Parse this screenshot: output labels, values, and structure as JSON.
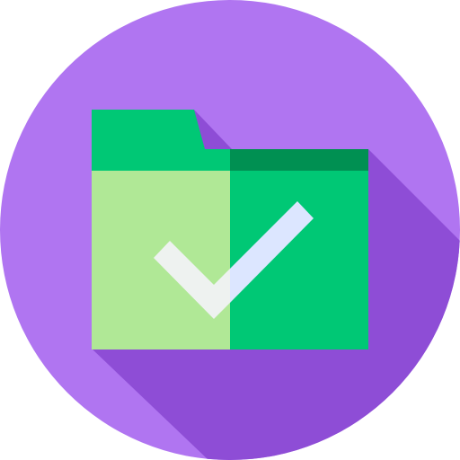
{
  "icon": {
    "name": "folder-check-icon",
    "colors": {
      "circle_bg": "#B075F1",
      "long_shadow": "#8E4DD6",
      "folder_tab": "#00C875",
      "folder_left_panel": "#B0E896",
      "folder_right_panel": "#00C875",
      "folder_right_top_band": "#009052",
      "check_left": "#EEF2F0",
      "check_right": "#DCE6FF"
    }
  }
}
